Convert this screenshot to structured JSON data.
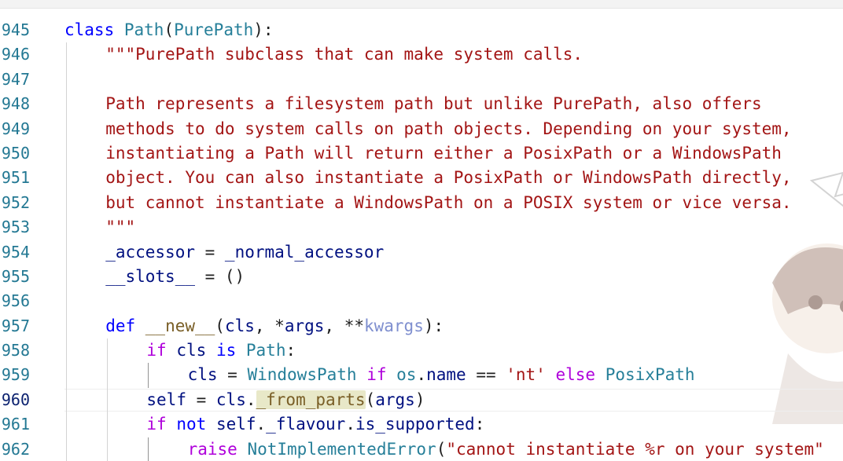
{
  "lines": [
    {
      "num": "945",
      "html": "<span class=\"kw\">class</span> <span class=\"cls\">Path</span>(<span class=\"cls\">PurePath</span>):",
      "indent": 0
    },
    {
      "num": "946",
      "html": "<span class=\"str\">\"\"\"PurePath subclass that can make system calls.</span>",
      "indent": 1
    },
    {
      "num": "947",
      "html": "",
      "indent": 1
    },
    {
      "num": "948",
      "html": "<span class=\"str\">Path represents a filesystem path but unlike PurePath, also offers</span>",
      "indent": 1
    },
    {
      "num": "949",
      "html": "<span class=\"str\">methods to do system calls on path objects. Depending on your system,</span>",
      "indent": 1
    },
    {
      "num": "950",
      "html": "<span class=\"str\">instantiating a Path will return either a PosixPath or a WindowsPath</span>",
      "indent": 1
    },
    {
      "num": "951",
      "html": "<span class=\"str\">object. You can also instantiate a PosixPath or WindowsPath directly,</span>",
      "indent": 1
    },
    {
      "num": "952",
      "html": "<span class=\"str\">but cannot instantiate a WindowsPath on a POSIX system or vice versa.</span>",
      "indent": 1
    },
    {
      "num": "953",
      "html": "<span class=\"str\">\"\"\"</span>",
      "indent": 1
    },
    {
      "num": "954",
      "html": "<span class=\"param\">_accessor</span> = <span class=\"param\">_normal_accessor</span>",
      "indent": 1
    },
    {
      "num": "955",
      "html": "<span class=\"param\">__slots__</span> = ()",
      "indent": 1
    },
    {
      "num": "956",
      "html": "",
      "indent": 1
    },
    {
      "num": "957",
      "html": "<span class=\"kw\">def</span> <span class=\"fn\">__new__</span>(<span class=\"param\">cls</span>, *<span class=\"param\">args</span>, **<span class=\"soft\">kwargs</span>):",
      "indent": 1
    },
    {
      "num": "958",
      "html": "<span class=\"kw2\">if</span> <span class=\"param\">cls</span> <span class=\"kw\">is</span> <span class=\"cls\">Path</span>:",
      "indent": 2
    },
    {
      "num": "959",
      "html": "<span class=\"param\">cls</span> = <span class=\"cls\">WindowsPath</span> <span class=\"kw2\">if</span> <span class=\"cls\">os</span>.<span class=\"param\">name</span> == <span class=\"str\">'nt'</span> <span class=\"kw2\">else</span> <span class=\"cls\">PosixPath</span>",
      "indent": 3
    },
    {
      "num": "960",
      "html": "<span class=\"param\">self</span> = <span class=\"param\">cls</span>.<span class=\"fn sel\">_from_parts</span>(<span class=\"param\">args</span>)",
      "indent": 2,
      "current": true
    },
    {
      "num": "961",
      "html": "<span class=\"kw2\">if</span> <span class=\"kw\">not</span> <span class=\"param\">self</span>.<span class=\"param\">_flavour</span>.<span class=\"param\">is_supported</span>:",
      "indent": 2
    },
    {
      "num": "962",
      "html": "<span class=\"kw2\">raise</span> <span class=\"cls\">NotImplementedError</span>(<span class=\"str\">\"cannot instantiate %r on your system\"</span>",
      "indent": 3
    }
  ],
  "colors": {
    "keyword": "#0000ff",
    "control": "#af00db",
    "class": "#267f99",
    "string": "#a31515",
    "variable": "#001080",
    "function": "#795e26",
    "line_number": "#237893",
    "current_line_number": "#0b216f"
  },
  "current_line": "960"
}
